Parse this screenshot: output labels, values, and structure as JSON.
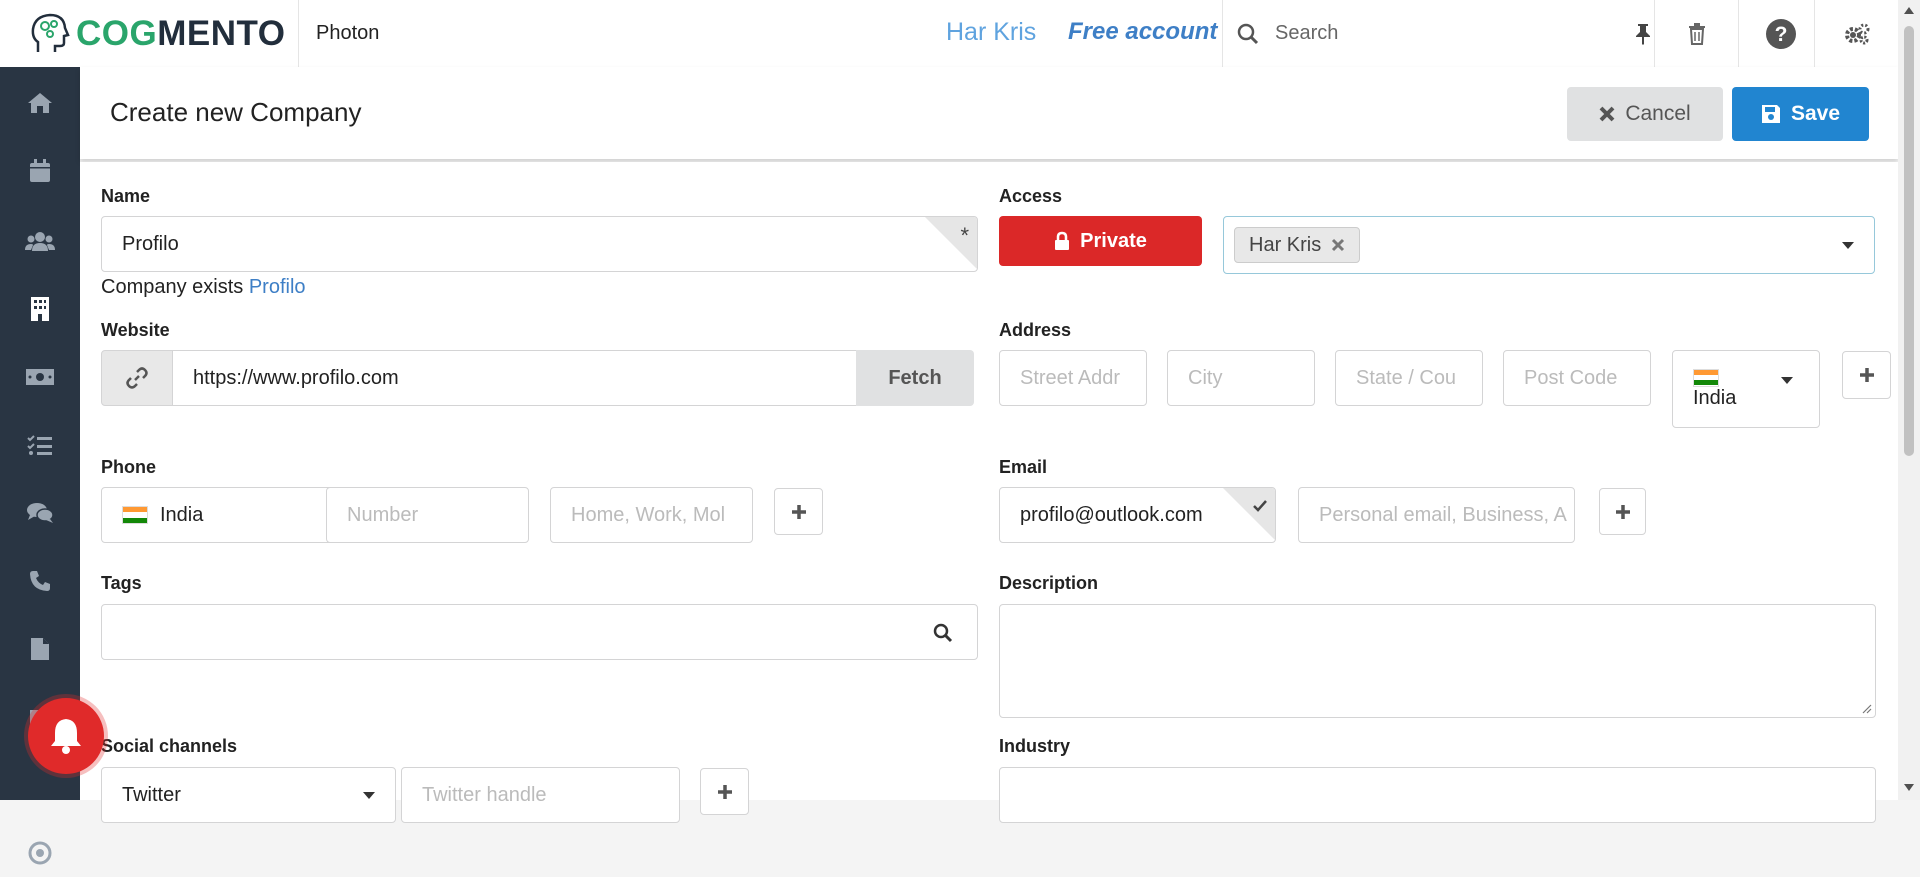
{
  "header": {
    "logo": {
      "part1": "COG",
      "part2": "MENTO"
    },
    "instance": "Photon",
    "user": "Har Kris",
    "account": "Free account",
    "search_placeholder": "Search"
  },
  "page": {
    "title": "Create new Company",
    "cancel_label": "Cancel",
    "save_label": "Save"
  },
  "form": {
    "name": {
      "label": "Name",
      "value": "Profilo",
      "required_mark": "*"
    },
    "company_exists": {
      "text": "Company exists",
      "link": "Profilo"
    },
    "access": {
      "label": "Access",
      "button": "Private",
      "tag": "Har Kris"
    },
    "website": {
      "label": "Website",
      "value": "https://www.profilo.com",
      "fetch_label": "Fetch"
    },
    "address": {
      "label": "Address",
      "street_placeholder": "Street Addr",
      "city_placeholder": "City",
      "state_placeholder": "State / Cou",
      "postcode_placeholder": "Post Code",
      "country": "India"
    },
    "phone": {
      "label": "Phone",
      "country": "India",
      "number_placeholder": "Number",
      "type_placeholder": "Home, Work, Mol"
    },
    "email": {
      "label": "Email",
      "value": "profilo@outlook.com",
      "type_placeholder": "Personal email, Business, A"
    },
    "tags": {
      "label": "Tags"
    },
    "description": {
      "label": "Description"
    },
    "social": {
      "label": "Social channels",
      "network": "Twitter",
      "handle_placeholder": "Twitter handle"
    },
    "industry": {
      "label": "Industry"
    }
  },
  "sidebar": {
    "icons": [
      "home-icon",
      "calendar-icon",
      "contacts-icon",
      "companies-icon",
      "deals-icon",
      "tasks-icon",
      "cases-icon",
      "calls-icon",
      "documents-icon",
      "email-icon",
      "campaigns-icon"
    ]
  },
  "colors": {
    "sidebar": "#293543",
    "save": "#2185d0",
    "private": "#db2828",
    "link": "#3e7fc6"
  }
}
